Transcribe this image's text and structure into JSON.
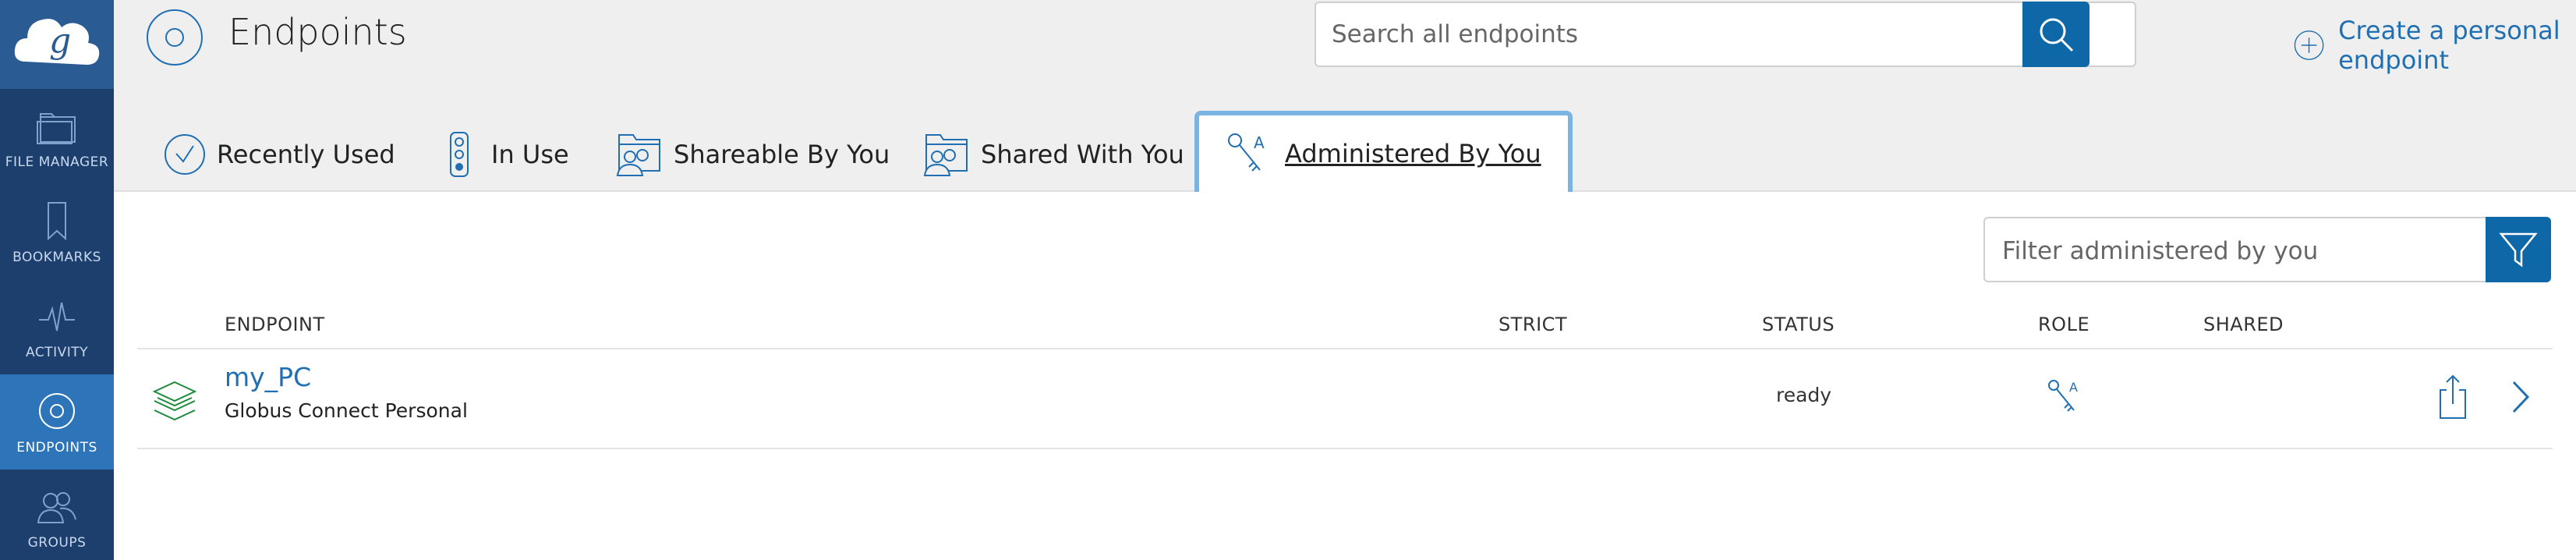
{
  "colors": {
    "sidebar_bg": "#1d3f6e",
    "sidebar_active": "#2e74b8",
    "header_bg": "#efefef",
    "accent": "#0e68a8",
    "link": "#1f6fb2",
    "active_tab_border": "#79b4e3",
    "endpoint_icon_green": "#1e8a3c"
  },
  "sidebar": {
    "logo_icon": "globus-cloud-logo",
    "items": [
      {
        "label": "FILE MANAGER",
        "icon": "folder-icon",
        "active": false
      },
      {
        "label": "BOOKMARKS",
        "icon": "bookmark-icon",
        "active": false
      },
      {
        "label": "ACTIVITY",
        "icon": "pulse-icon",
        "active": false
      },
      {
        "label": "ENDPOINTS",
        "icon": "endpoint-circle-icon",
        "active": true
      },
      {
        "label": "GROUPS",
        "icon": "people-icon",
        "active": false
      }
    ]
  },
  "header": {
    "title": "Endpoints",
    "search": {
      "placeholder": "Search all endpoints",
      "value": ""
    },
    "create_link": "Create a personal endpoint"
  },
  "tabs": [
    {
      "label": "Recently Used",
      "icon": "clock-icon",
      "active": false
    },
    {
      "label": "In Use",
      "icon": "traffic-light-icon",
      "active": false
    },
    {
      "label": "Shareable By You",
      "icon": "shared-folder-people-icon",
      "active": false
    },
    {
      "label": "Shared With You",
      "icon": "shared-folder-people-icon",
      "active": false
    },
    {
      "label": "Administered By You",
      "icon": "keys-icon",
      "active": true
    }
  ],
  "filter": {
    "placeholder": "Filter administered by you",
    "value": ""
  },
  "table": {
    "columns": [
      "ENDPOINT",
      "STRICT",
      "STATUS",
      "ROLE",
      "SHARED"
    ],
    "rows": [
      {
        "name": "my_PC",
        "type": "Globus Connect Personal",
        "strict": "",
        "status": "ready",
        "role_icon": "keys-icon",
        "shared": ""
      }
    ]
  }
}
